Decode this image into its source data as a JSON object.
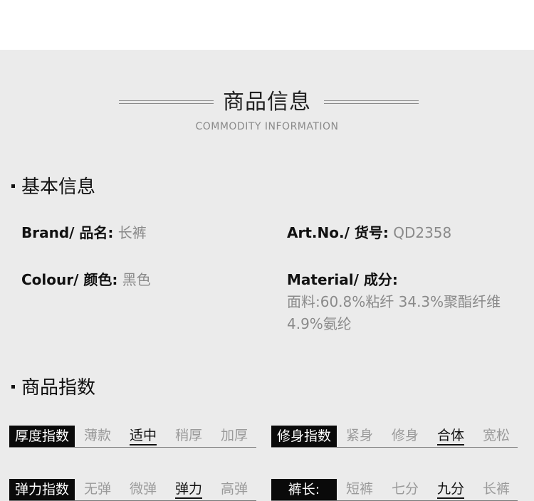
{
  "header": {
    "title": "商品信息",
    "subtitle": "COMMODITY INFORMATION"
  },
  "basic": {
    "heading": "基本信息",
    "brand_label": "Brand/ 品名:",
    "brand_value": "长裤",
    "art_label": "Art.No./ 货号:",
    "art_value": "QD2358",
    "colour_label": "Colour/ 颜色:",
    "colour_value": "黑色",
    "material_label": "Material/ 成分:",
    "material_line1": "面料:60.8%粘纤 34.3%聚酯纤维",
    "material_line2": "4.9%氨纶"
  },
  "index": {
    "heading": "商品指数",
    "thickness": {
      "tag": "厚度指数",
      "options": [
        "薄款",
        "适中",
        "稍厚",
        "加厚"
      ],
      "selected": "适中"
    },
    "fit": {
      "tag": "修身指数",
      "options": [
        "紧身",
        "修身",
        "合体",
        "宽松"
      ],
      "selected": "合体"
    },
    "stretch": {
      "tag": "弹力指数",
      "options": [
        "无弹",
        "微弹",
        "弹力",
        "高弹"
      ],
      "selected": "弹力"
    },
    "length": {
      "tag": "裤长:",
      "options": [
        "短裤",
        "七分",
        "九分",
        "长裤"
      ],
      "selected": "九分"
    }
  }
}
